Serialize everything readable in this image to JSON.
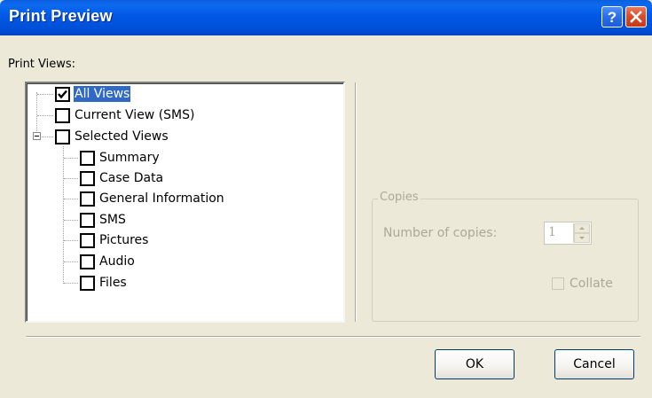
{
  "window": {
    "title": "Print Preview",
    "help_glyph": "?",
    "close_icon": "close-icon"
  },
  "print_views": {
    "label": "Print Views:",
    "items": [
      {
        "label": "All Views",
        "checked": true,
        "selected": true
      },
      {
        "label": "Current View (SMS)",
        "checked": false
      },
      {
        "label": "Selected Views",
        "checked": false,
        "expanded": true
      },
      {
        "label": "Summary",
        "checked": false
      },
      {
        "label": "Case Data",
        "checked": false
      },
      {
        "label": "General Information",
        "checked": false
      },
      {
        "label": "SMS",
        "checked": false
      },
      {
        "label": "Pictures",
        "checked": false
      },
      {
        "label": "Audio",
        "checked": false
      },
      {
        "label": "Files",
        "checked": false
      }
    ]
  },
  "copies": {
    "group_title": "Copies",
    "number_label": "Number of copies:",
    "number_value": "1",
    "collate_label": "Collate",
    "collate_checked": false,
    "enabled": false
  },
  "buttons": {
    "ok": "OK",
    "cancel": "Cancel"
  },
  "colors": {
    "titlebar": "#0058e6",
    "dialog_bg": "#ece9d8",
    "selection": "#316ac5",
    "disabled_text": "#aca899"
  }
}
